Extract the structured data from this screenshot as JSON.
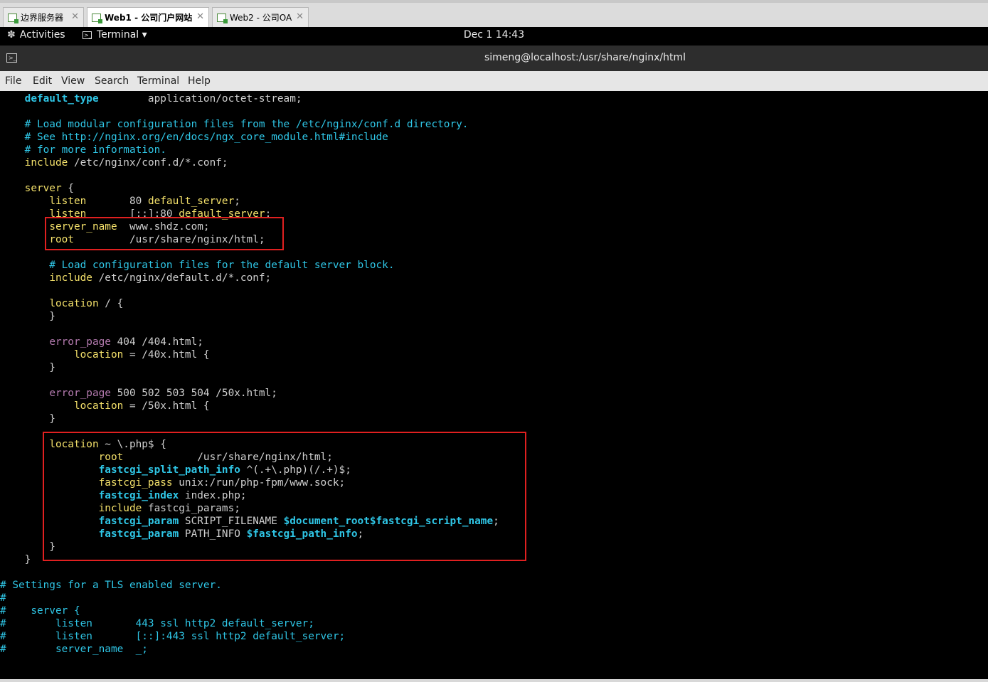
{
  "tabs": [
    {
      "label": "边界服务器",
      "active": false
    },
    {
      "label": "Web1 - 公司门户网站",
      "active": true
    },
    {
      "label": "Web2 - 公司OA",
      "active": false
    }
  ],
  "topbar": {
    "activities": "Activities",
    "terminal_menu": "Terminal ▾",
    "clock": "Dec 1  14:43"
  },
  "window": {
    "title": "simeng@localhost:/usr/share/nginx/html"
  },
  "menu": [
    "File",
    "Edit",
    "View",
    "Search",
    "Terminal",
    "Help"
  ],
  "colors": {
    "highlight_box": "#e02020",
    "keyword_yellow": "#f3e06a",
    "cyan": "#2fc6e6",
    "purple": "#b57bb0"
  },
  "terminal_lines": [
    [
      {
        "t": "    "
      },
      {
        "t": "default_type",
        "c": "cb"
      },
      {
        "t": "        application/octet-stream;"
      }
    ],
    [],
    [
      {
        "t": "    # Load modular configuration files from the /etc/nginx/conf.d directory.",
        "c": "c"
      }
    ],
    [
      {
        "t": "    # See http://nginx.org/en/docs/ngx_core_module.html#include",
        "c": "c"
      }
    ],
    [
      {
        "t": "    # for more information.",
        "c": "c"
      }
    ],
    [
      {
        "t": "    "
      },
      {
        "t": "include",
        "c": "y"
      },
      {
        "t": " /etc/nginx/conf.d/*.conf;"
      }
    ],
    [],
    [
      {
        "t": "    "
      },
      {
        "t": "server",
        "c": "y"
      },
      {
        "t": " {"
      }
    ],
    [
      {
        "t": "        "
      },
      {
        "t": "listen",
        "c": "y"
      },
      {
        "t": "       80 "
      },
      {
        "t": "default_server",
        "c": "y"
      },
      {
        "t": ";"
      }
    ],
    [
      {
        "t": "        "
      },
      {
        "t": "listen",
        "c": "y"
      },
      {
        "t": "       [::]:80 "
      },
      {
        "t": "default_server",
        "c": "y"
      },
      {
        "t": ";"
      }
    ],
    [
      {
        "t": "        "
      },
      {
        "t": "server_name",
        "c": "y"
      },
      {
        "t": "  www.shdz.com;"
      }
    ],
    [
      {
        "t": "        "
      },
      {
        "t": "root",
        "c": "y"
      },
      {
        "t": "         /usr/share/nginx/html;"
      }
    ],
    [],
    [
      {
        "t": "        # Load configuration files for the default server block.",
        "c": "c"
      }
    ],
    [
      {
        "t": "        "
      },
      {
        "t": "include",
        "c": "y"
      },
      {
        "t": " /etc/nginx/default.d/*.conf;"
      }
    ],
    [],
    [
      {
        "t": "        "
      },
      {
        "t": "location",
        "c": "y"
      },
      {
        "t": " / {"
      }
    ],
    [
      {
        "t": "        }"
      }
    ],
    [],
    [
      {
        "t": "        "
      },
      {
        "t": "error_page",
        "c": "p"
      },
      {
        "t": " 404 /404.html;"
      }
    ],
    [
      {
        "t": "            "
      },
      {
        "t": "location",
        "c": "y"
      },
      {
        "t": " = /40x.html {"
      }
    ],
    [
      {
        "t": "        }"
      }
    ],
    [],
    [
      {
        "t": "        "
      },
      {
        "t": "error_page",
        "c": "p"
      },
      {
        "t": " 500 502 503 504 /50x.html;"
      }
    ],
    [
      {
        "t": "            "
      },
      {
        "t": "location",
        "c": "y"
      },
      {
        "t": " = /50x.html {"
      }
    ],
    [
      {
        "t": "        }"
      }
    ],
    [],
    [
      {
        "t": "        "
      },
      {
        "t": "location",
        "c": "y"
      },
      {
        "t": " ~ \\.php$ {"
      }
    ],
    [
      {
        "t": "                "
      },
      {
        "t": "root",
        "c": "y"
      },
      {
        "t": "            /usr/share/nginx/html;"
      }
    ],
    [
      {
        "t": "                "
      },
      {
        "t": "fastcgi_split_path_info",
        "c": "cb"
      },
      {
        "t": " ^(.+\\.php)(/.+)$;"
      }
    ],
    [
      {
        "t": "                "
      },
      {
        "t": "fastcgi_pass",
        "c": "y"
      },
      {
        "t": " unix:/run/php-fpm/www.sock;"
      }
    ],
    [
      {
        "t": "                "
      },
      {
        "t": "fastcgi_index",
        "c": "cb"
      },
      {
        "t": " index.php;"
      }
    ],
    [
      {
        "t": "                "
      },
      {
        "t": "include",
        "c": "y"
      },
      {
        "t": " fastcgi_params;"
      }
    ],
    [
      {
        "t": "                "
      },
      {
        "t": "fastcgi_param",
        "c": "cb"
      },
      {
        "t": " SCRIPT_FILENAME "
      },
      {
        "t": "$document_root$fastcgi_script_name",
        "c": "cb"
      },
      {
        "t": ";"
      }
    ],
    [
      {
        "t": "                "
      },
      {
        "t": "fastcgi_param",
        "c": "cb"
      },
      {
        "t": " PATH_INFO "
      },
      {
        "t": "$fastcgi_path_info",
        "c": "cb"
      },
      {
        "t": ";"
      }
    ],
    [
      {
        "t": "        }"
      }
    ],
    [
      {
        "t": "    }"
      }
    ],
    [],
    [
      {
        "t": "# Settings for a TLS enabled server.",
        "c": "c"
      }
    ],
    [
      {
        "t": "#",
        "c": "c"
      }
    ],
    [
      {
        "t": "#    server {",
        "c": "c"
      }
    ],
    [
      {
        "t": "#        listen       443 ssl http2 default_server;",
        "c": "c"
      }
    ],
    [
      {
        "t": "#        listen       [::]:443 ssl http2 default_server;",
        "c": "c"
      }
    ],
    [
      {
        "t": "#        server_name  _;",
        "c": "c"
      }
    ]
  ]
}
